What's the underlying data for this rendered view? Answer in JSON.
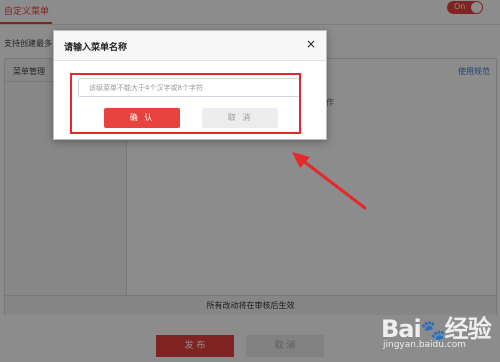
{
  "header": {
    "tab_title": "自定义菜单",
    "toggle_label": "On"
  },
  "page": {
    "support_text": "支持创建最多",
    "menu_management": "菜单管理",
    "usage_link": "使用规范",
    "hint_text": "作",
    "footer_note": "所有改动将在审核后生效",
    "publish_label": "发 布",
    "cancel_label": "取 消"
  },
  "dialog": {
    "title": "请输入菜单名称",
    "close_symbol": "×",
    "input_value": "",
    "input_placeholder": "该级菜单不能大于4个汉字或8个字符",
    "confirm_label": "确 认",
    "cancel_label": "取 消"
  },
  "watermark": {
    "logo": "Bai du 经验",
    "url": "jingyan.baidu.com"
  },
  "colors": {
    "accent": "#e8423f",
    "annotation": "#e5282c"
  }
}
